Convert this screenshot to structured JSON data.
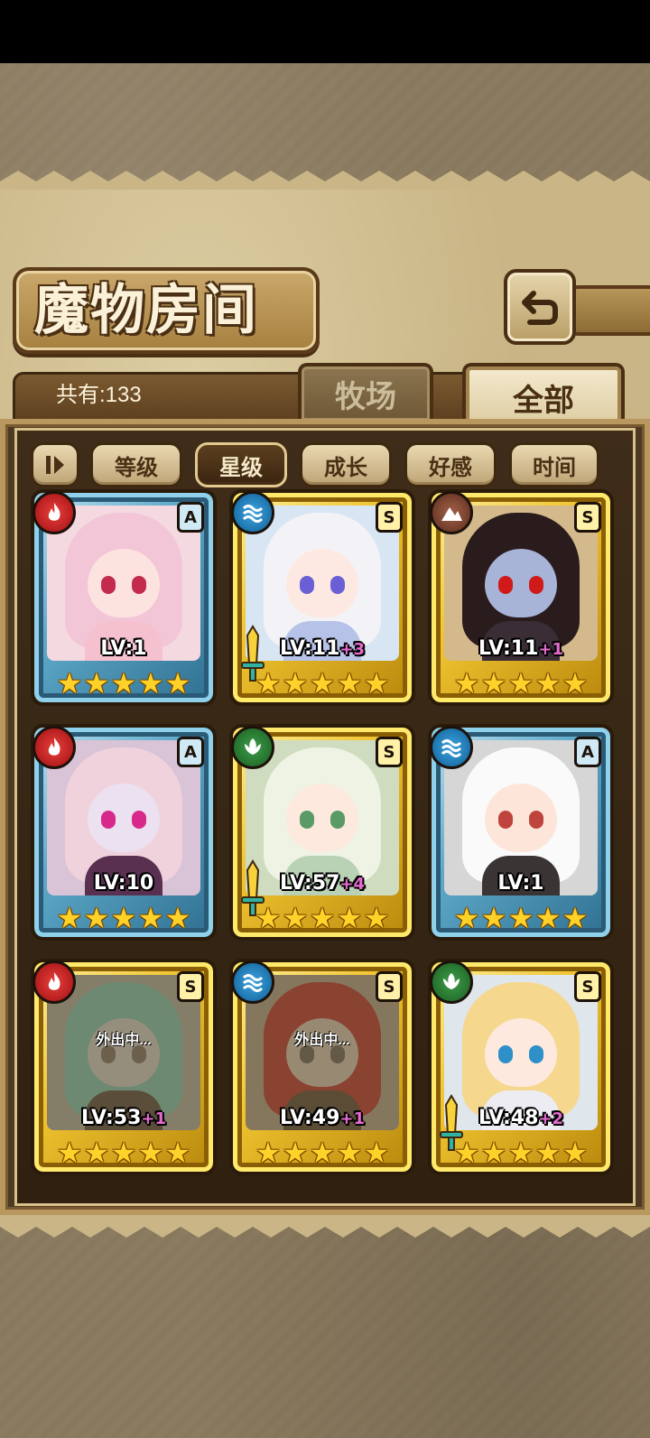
{
  "title": "魔物房间",
  "count_label": "共有:133",
  "tabs": [
    {
      "label": "牧场",
      "active": false
    },
    {
      "label": "全部",
      "active": true
    }
  ],
  "sort_buttons": [
    {
      "label": "等级",
      "active": false
    },
    {
      "label": "星级",
      "active": true
    },
    {
      "label": "成长",
      "active": false
    },
    {
      "label": "好感",
      "active": false
    },
    {
      "label": "时间",
      "active": false
    }
  ],
  "colors": {
    "fire": "#d22a2a",
    "water": "#1f86c8",
    "earth": "#7d3f2c",
    "wood": "#2d7f36",
    "level_plus": "#e66bd0",
    "star": "#ffd22a"
  },
  "monsters": [
    {
      "element": "fire",
      "rank": "A",
      "level": "LV:1",
      "plus": "",
      "stars": 5,
      "weapon": false,
      "away": false,
      "hair": "#f2c6d6",
      "face": "#fde3e0",
      "eye": "#c22a4e",
      "body": "#f6c1cf",
      "bg": "#f5d9e1"
    },
    {
      "element": "water",
      "rank": "S",
      "level": "LV:11",
      "plus": "+3",
      "stars": 5,
      "weapon": true,
      "away": false,
      "hair": "#f3f3f7",
      "face": "#fde9e2",
      "eye": "#6b5fd6",
      "body": "#b6c2e8",
      "bg": "#d8e6f3"
    },
    {
      "element": "earth",
      "rank": "S",
      "level": "LV:11",
      "plus": "+1",
      "stars": 5,
      "weapon": false,
      "away": false,
      "hair": "#2a1c1c",
      "face": "#a8b3d8",
      "eye": "#d01a1a",
      "body": "#3a2d36",
      "bg": "#d3b98b"
    },
    {
      "element": "fire",
      "rank": "A",
      "level": "LV:10",
      "plus": "",
      "stars": 5,
      "weapon": false,
      "away": false,
      "hair": "#f0d2dc",
      "face": "#ece1f0",
      "eye": "#d7298c",
      "body": "#5a3050",
      "bg": "#d9c3d6"
    },
    {
      "element": "wood",
      "rank": "S",
      "level": "LV:57",
      "plus": "+4",
      "stars": 5,
      "weapon": true,
      "away": false,
      "hair": "#eef3e4",
      "face": "#fde9de",
      "eye": "#5a9a66",
      "body": "#b9d2b5",
      "bg": "#cfdcc0"
    },
    {
      "element": "water",
      "rank": "A",
      "level": "LV:1",
      "plus": "",
      "stars": 5,
      "weapon": false,
      "away": false,
      "hair": "#fafafa",
      "face": "#fde6d9",
      "eye": "#c0443e",
      "body": "#3b3434",
      "bg": "#d6d6d6"
    },
    {
      "element": "fire",
      "rank": "S",
      "level": "LV:53",
      "plus": "+1",
      "stars": 5,
      "weapon": false,
      "away": true,
      "away_label": "外出中...",
      "hair": "#8ec9b0",
      "face": "#d7d1c2",
      "eye": "#8a7f6b",
      "body": "#6a5e4a",
      "bg": "#b7b29c"
    },
    {
      "element": "water",
      "rank": "S",
      "level": "LV:49",
      "plus": "+1",
      "stars": 5,
      "weapon": false,
      "away": true,
      "away_label": "外出中...",
      "hair": "#c2483a",
      "face": "#d9c8b0",
      "eye": "#7c7060",
      "body": "#6c5a40",
      "bg": "#b8a88a"
    },
    {
      "element": "wood",
      "rank": "S",
      "level": "LV:48",
      "plus": "+2",
      "stars": 5,
      "weapon": true,
      "away": false,
      "hair": "#f6d78e",
      "face": "#fde9de",
      "eye": "#2d90c8",
      "body": "#ececf2",
      "bg": "#dfe6ec"
    }
  ]
}
